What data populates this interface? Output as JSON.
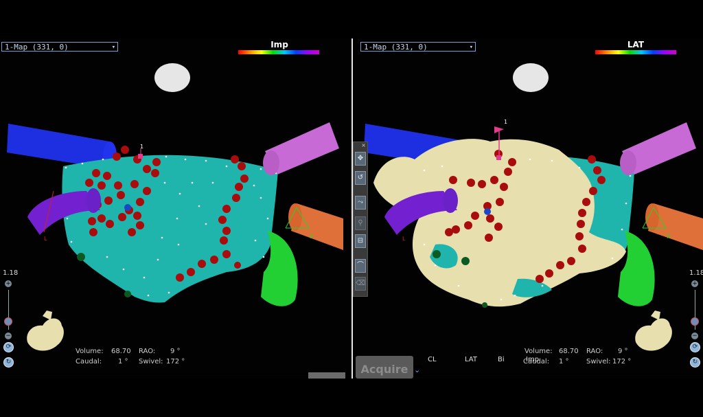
{
  "left_pane": {
    "map_selector": "1-Map (331, 0)",
    "scale_label": "Imp",
    "zoom_value": "1.18",
    "stats": {
      "volume_label": "Volume:",
      "volume_value": "68.70",
      "rao_label": "RAO:",
      "rao_value": "9 °",
      "caudal_label": "Caudal:",
      "caudal_value": "1 °",
      "swivel_label": "Swivel:",
      "swivel_value": "172 °"
    },
    "marker_label": "1",
    "axis_l": "L",
    "axis_r": "R"
  },
  "right_pane": {
    "map_selector": "1-Map (331, 0)",
    "scale_label": "LAT",
    "zoom_value": "1.18",
    "stats": {
      "volume_label": "Volume:",
      "volume_value": "68.70",
      "rao_label": "RAO:",
      "rao_value": "9 °",
      "caudal_label": "Caudal:",
      "caudal_value": "1 °",
      "swivel_label": "Swivel:",
      "swivel_value": "172 °"
    },
    "marker_label": "1",
    "axis_l": "L",
    "axis_r": "R"
  },
  "bottom_panel": {
    "acquire_label": "Acquire",
    "columns": [
      "CL",
      "LAT",
      "Bi",
      "Imp"
    ]
  },
  "tool_palette": {
    "close_glyph": "×"
  },
  "colors": {
    "teal_map": "#1fb5ac",
    "cream_map": "#e7e0ae",
    "ablation_red": "#a80c0c",
    "vessel_blue": "#1d2fe0",
    "vessel_purple": "#7220d0",
    "vessel_violet": "#c86ad6",
    "vessel_orange": "#e0703a",
    "vessel_green": "#22d034"
  },
  "icons": [
    "zoom-in-icon",
    "zoom-out-icon",
    "rotate-icon",
    "heart-thumbnail-icon",
    "target-marker-icon",
    "ablation-tag-icon"
  ]
}
